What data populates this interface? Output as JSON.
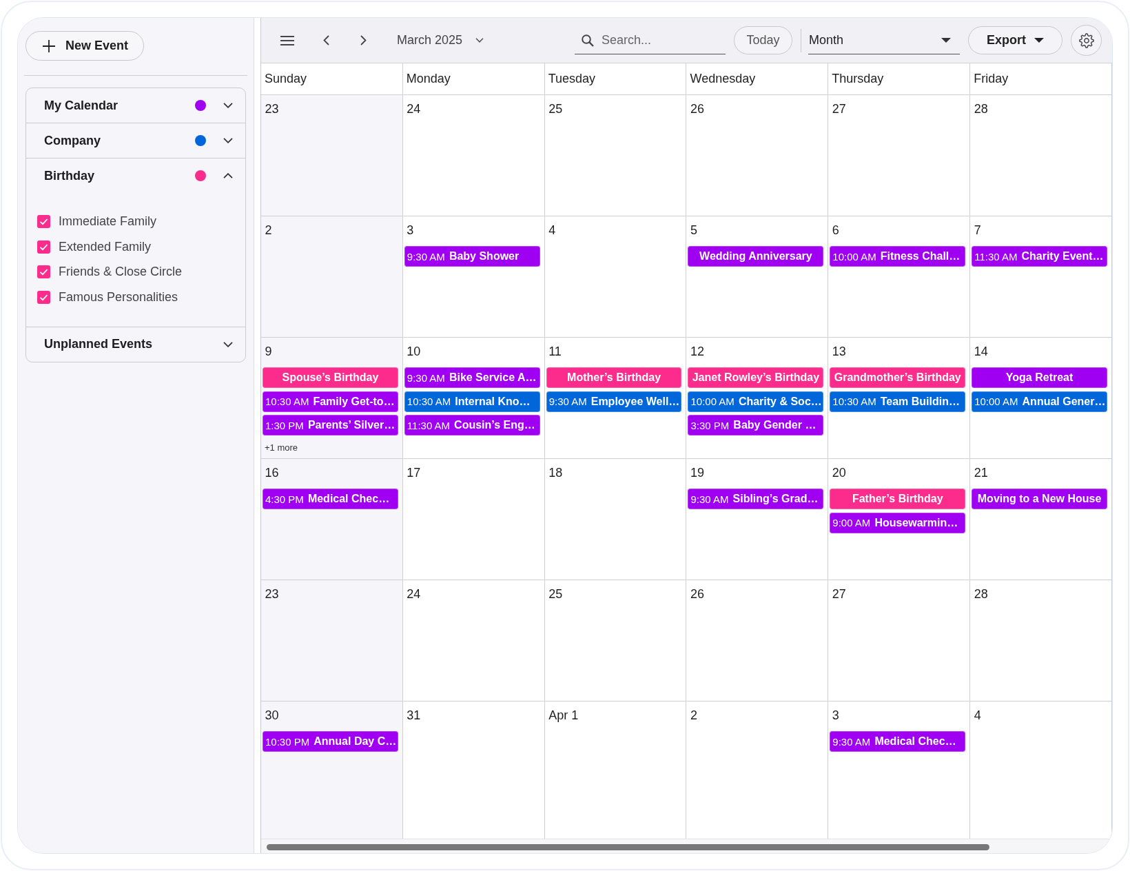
{
  "sidebar": {
    "new_event_button": "New Event",
    "calendars": [
      {
        "label": "My Calendar",
        "color": "#a000f2",
        "expanded": false
      },
      {
        "label": "Company",
        "color": "#0066da",
        "expanded": false
      },
      {
        "label": "Birthday",
        "color": "#fb2c8c",
        "expanded": true,
        "items": [
          {
            "label": "Immediate Family",
            "checked": true
          },
          {
            "label": "Extended Family",
            "checked": true
          },
          {
            "label": "Friends & Close Circle",
            "checked": true
          },
          {
            "label": "Famous Personalities",
            "checked": true
          }
        ]
      },
      {
        "label": "Unplanned Events",
        "expanded": false
      }
    ]
  },
  "toolbar": {
    "month_title": "March 2025",
    "search": {
      "placeholder": "Search..."
    },
    "today_button": "Today",
    "view_select": "Month",
    "export_button": "Export"
  },
  "calendar": {
    "weekdays": [
      "Sunday",
      "Monday",
      "Tuesday",
      "Wednesday",
      "Thursday",
      "Friday"
    ],
    "weeks": [
      [
        {
          "date": "23"
        },
        {
          "date": "24"
        },
        {
          "date": "25"
        },
        {
          "date": "26"
        },
        {
          "date": "27"
        },
        {
          "date": "28"
        }
      ],
      [
        {
          "date": "2"
        },
        {
          "date": "3",
          "events": [
            {
              "time": "9:30 AM",
              "title": "Baby Shower",
              "color": "#a000f2"
            }
          ]
        },
        {
          "date": "4"
        },
        {
          "date": "5",
          "events": [
            {
              "title": "Wedding Anniversary",
              "color": "#a000f2"
            }
          ]
        },
        {
          "date": "6",
          "events": [
            {
              "time": "10:00 AM",
              "title": "Fitness Chall…",
              "color": "#a000f2"
            }
          ]
        },
        {
          "date": "7",
          "events": [
            {
              "time": "11:30 AM",
              "title": "Charity Event…",
              "color": "#a000f2"
            }
          ]
        }
      ],
      [
        {
          "date": "9",
          "events": [
            {
              "title": "Spouse’s Birthday",
              "color": "#fb2c8c"
            },
            {
              "time": "10:30 AM",
              "title": "Family Get-to…",
              "color": "#a000f2"
            },
            {
              "time": "1:30 PM",
              "title": "Parents’ Silver…",
              "color": "#a000f2"
            }
          ],
          "more": "+1 more"
        },
        {
          "date": "10",
          "events": [
            {
              "time": "9:30 AM",
              "title": "Bike Service A…",
              "color": "#a000f2"
            },
            {
              "time": "10:30 AM",
              "title": "Internal Kno…",
              "color": "#0066da"
            },
            {
              "time": "11:30 AM",
              "title": "Cousin’s Eng…",
              "color": "#a000f2"
            }
          ]
        },
        {
          "date": "11",
          "events": [
            {
              "title": "Mother’s Birthday",
              "color": "#fb2c8c"
            },
            {
              "time": "9:30 AM",
              "title": "Employee Well…",
              "color": "#0066da"
            }
          ]
        },
        {
          "date": "12",
          "events": [
            {
              "title": "Janet Rowley’s Birthday",
              "color": "#fb2c8c"
            },
            {
              "time": "10:00 AM",
              "title": "Charity & Soc…",
              "color": "#0066da"
            },
            {
              "time": "3:30 PM",
              "title": "Baby Gender …",
              "color": "#a000f2"
            }
          ]
        },
        {
          "date": "13",
          "events": [
            {
              "title": "Grandmother’s Birthday",
              "color": "#fb2c8c"
            },
            {
              "time": "10:30 AM",
              "title": "Team Buildin…",
              "color": "#0066da"
            }
          ]
        },
        {
          "date": "14",
          "events": [
            {
              "title": "Yoga Retreat",
              "color": "#a000f2"
            },
            {
              "time": "10:00 AM",
              "title": "Annual Gener…",
              "color": "#0066da"
            }
          ]
        }
      ],
      [
        {
          "date": "16",
          "events": [
            {
              "time": "4:30 PM",
              "title": "Medical Chec…",
              "color": "#a000f2"
            }
          ]
        },
        {
          "date": "17"
        },
        {
          "date": "18"
        },
        {
          "date": "19",
          "events": [
            {
              "time": "9:30 AM",
              "title": "Sibling’s Grad…",
              "color": "#a000f2"
            }
          ]
        },
        {
          "date": "20",
          "events": [
            {
              "title": "Father’s Birthday",
              "color": "#fb2c8c"
            },
            {
              "time": "9:00 AM",
              "title": "Housewarmin…",
              "color": "#a000f2"
            }
          ]
        },
        {
          "date": "21",
          "events": [
            {
              "title": "Moving to a New House",
              "color": "#a000f2"
            }
          ]
        }
      ],
      [
        {
          "date": "23"
        },
        {
          "date": "24"
        },
        {
          "date": "25"
        },
        {
          "date": "26"
        },
        {
          "date": "27"
        },
        {
          "date": "28"
        }
      ],
      [
        {
          "date": "30",
          "events": [
            {
              "time": "10:30 PM",
              "title": "Annual Day C…",
              "color": "#a000f2"
            }
          ]
        },
        {
          "date": "31"
        },
        {
          "date": "Apr 1"
        },
        {
          "date": "2"
        },
        {
          "date": "3",
          "events": [
            {
              "time": "9:30 AM",
              "title": "Medical Chec…",
              "color": "#a000f2"
            }
          ]
        },
        {
          "date": "4"
        }
      ]
    ]
  }
}
